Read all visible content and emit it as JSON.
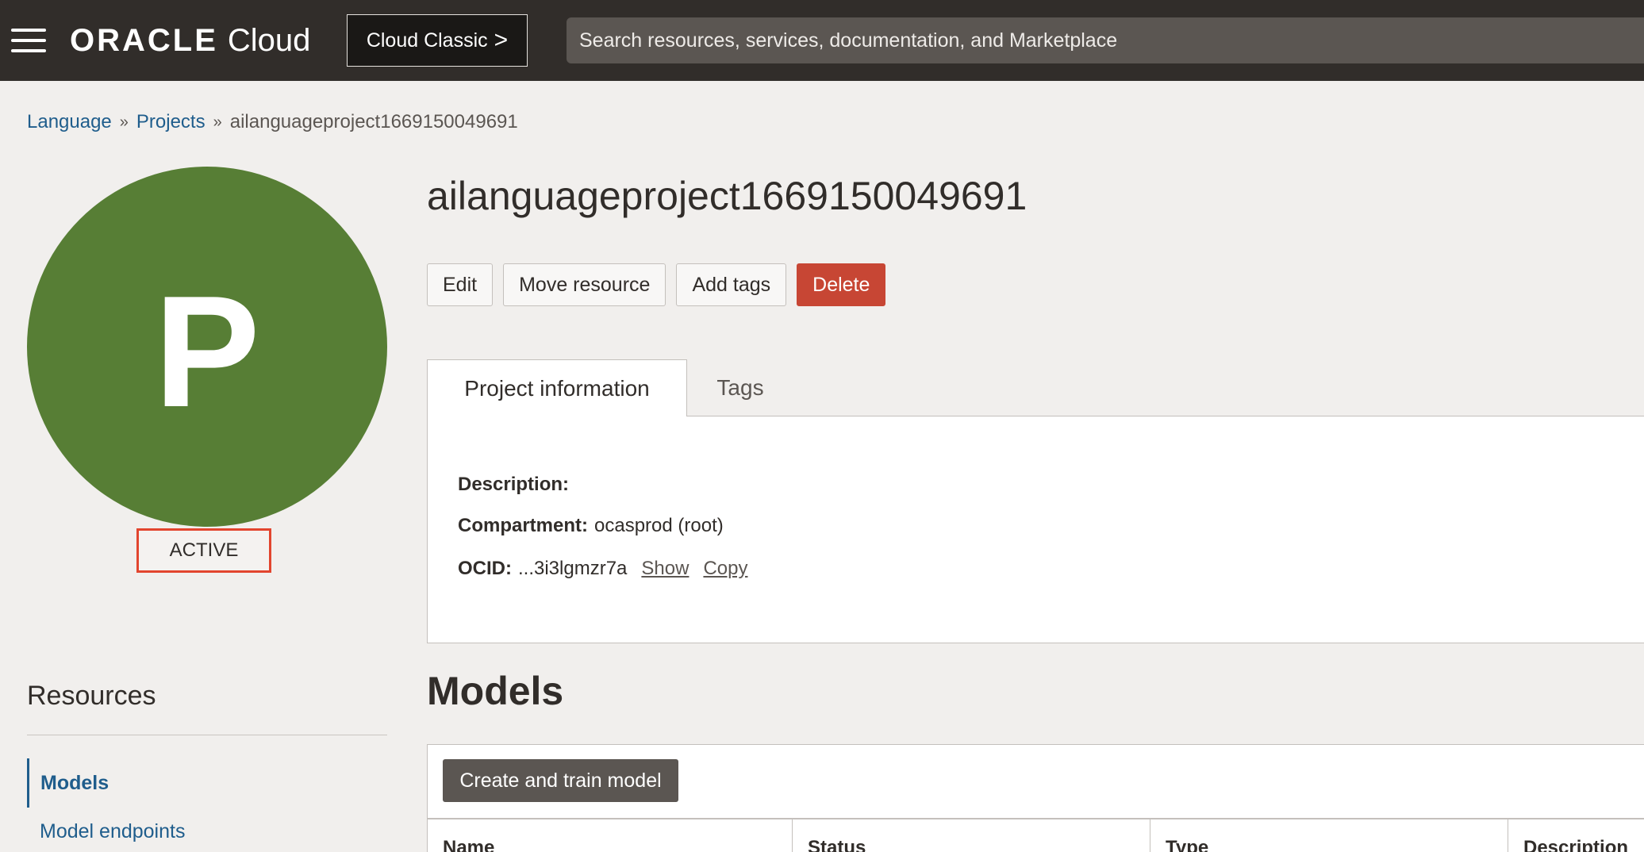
{
  "header": {
    "brand_oracle": "ORACLE",
    "brand_cloud": "Cloud",
    "classic_label": "Cloud Classic",
    "classic_chevron": ">",
    "search_placeholder": "Search resources, services, documentation, and Marketplace"
  },
  "breadcrumb": {
    "items": [
      "Language",
      "Projects"
    ],
    "separator": "»",
    "current": "ailanguageproject1669150049691"
  },
  "avatar": {
    "letter": "P",
    "status": "ACTIVE",
    "color": "#577e35"
  },
  "resources": {
    "title": "Resources",
    "items": [
      {
        "label": "Models",
        "active": true
      },
      {
        "label": "Model endpoints",
        "active": false
      }
    ]
  },
  "page": {
    "title": "ailanguageproject1669150049691",
    "actions": [
      "Edit",
      "Move resource",
      "Add tags",
      "Delete"
    ],
    "tabs": [
      "Project information",
      "Tags"
    ],
    "info": {
      "description_label": "Description:",
      "description_value": "",
      "compartment_label": "Compartment:",
      "compartment_value": "ocasprod (root)",
      "ocid_label": "OCID:",
      "ocid_value": "...3i3lgmzr7a",
      "show_link": "Show",
      "copy_link": "Copy"
    }
  },
  "models": {
    "title": "Models",
    "create_button": "Create and train model",
    "columns": [
      "Name",
      "Status",
      "Type",
      "Description"
    ]
  },
  "colors": {
    "accent_link": "#1f5d8c",
    "delete": "#c74634",
    "status_highlight": "#e2452e",
    "topbar": "#312d2a"
  }
}
